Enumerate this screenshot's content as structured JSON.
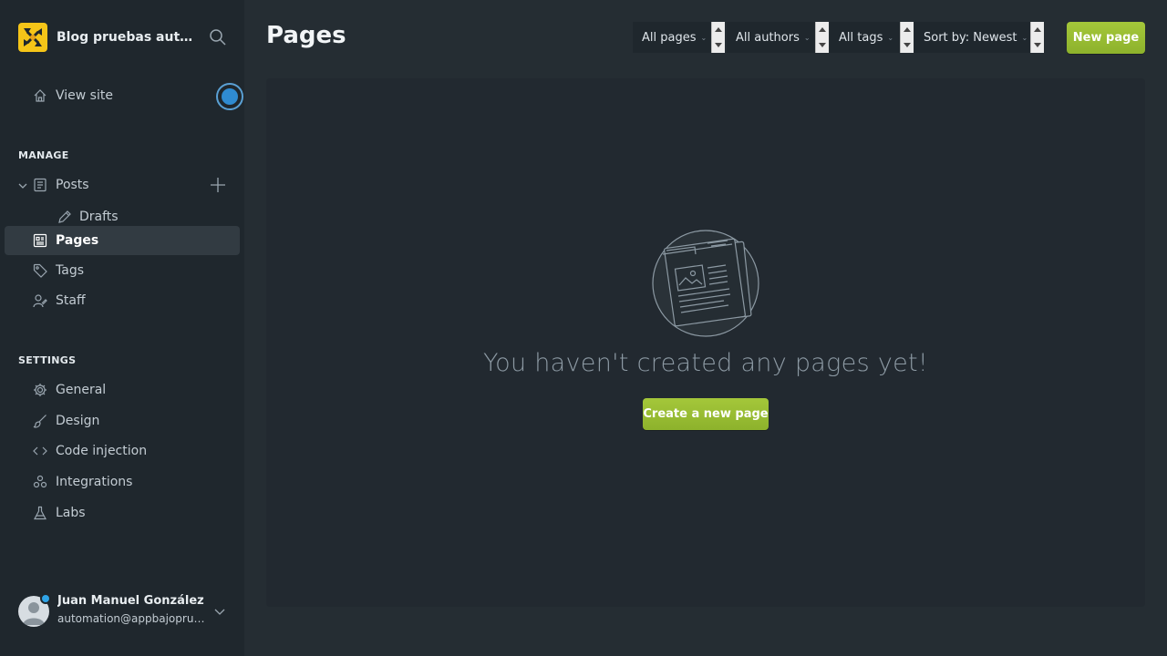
{
  "brand": {
    "title": "Blog pruebas automatizadas",
    "logo_colors": [
      "#f5c518",
      "#e8a317"
    ]
  },
  "sidebar": {
    "view_site": "View site",
    "manage_heading": "MANAGE",
    "settings_heading": "SETTINGS",
    "manage_items": [
      {
        "label": "Posts",
        "icon": "posts-icon"
      },
      {
        "label": "Drafts",
        "icon": "pencil-icon"
      },
      {
        "label": "Pages",
        "icon": "pages-icon",
        "active": true
      },
      {
        "label": "Tags",
        "icon": "tag-icon"
      },
      {
        "label": "Staff",
        "icon": "staff-icon"
      }
    ],
    "settings_items": [
      {
        "label": "General",
        "icon": "gear-icon"
      },
      {
        "label": "Design",
        "icon": "brush-icon"
      },
      {
        "label": "Code injection",
        "icon": "code-icon"
      },
      {
        "label": "Integrations",
        "icon": "integrations-icon"
      },
      {
        "label": "Labs",
        "icon": "flask-icon"
      }
    ]
  },
  "user": {
    "name": "Juan Manuel González",
    "email": "automation@appbajopruebas.com"
  },
  "header": {
    "title": "Pages",
    "filters": {
      "type": "All pages",
      "author": "All authors",
      "tag": "All tags",
      "sort": "Sort by: Newest"
    },
    "new_page_label": "New page"
  },
  "empty_state": {
    "message": "You haven't created any pages yet!",
    "create_label": "Create a new page"
  },
  "colors": {
    "accent_green": "#9bbe33",
    "sidebar_bg": "#1f272d",
    "main_bg": "#252d33",
    "notification_blue": "#2f8bd1"
  }
}
